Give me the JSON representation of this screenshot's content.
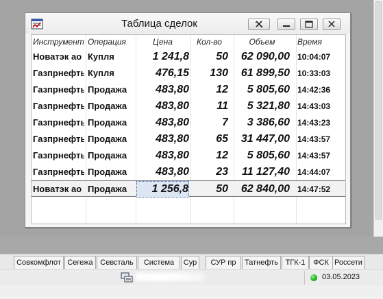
{
  "window": {
    "title": "Таблица сделок",
    "columns": {
      "instrument": "Инструмент",
      "operation": "Операция",
      "price": "Цена",
      "qty": "Кол-во",
      "volume": "Объем",
      "time": "Время"
    },
    "rows": [
      {
        "instrument": "Новатэк ао",
        "operation": "Купля",
        "price": "1 241,8",
        "qty": "50",
        "volume": "62 090,00",
        "time": "10:04:07"
      },
      {
        "instrument": "Газпрнефть",
        "operation": "Купля",
        "price": "476,15",
        "qty": "130",
        "volume": "61 899,50",
        "time": "10:33:03"
      },
      {
        "instrument": "Газпрнефть",
        "operation": "Продажа",
        "price": "483,80",
        "qty": "12",
        "volume": "5 805,60",
        "time": "14:42:36"
      },
      {
        "instrument": "Газпрнефть",
        "operation": "Продажа",
        "price": "483,80",
        "qty": "11",
        "volume": "5 321,80",
        "time": "14:43:03"
      },
      {
        "instrument": "Газпрнефть",
        "operation": "Продажа",
        "price": "483,80",
        "qty": "7",
        "volume": "3 386,60",
        "time": "14:43:23"
      },
      {
        "instrument": "Газпрнефть",
        "operation": "Продажа",
        "price": "483,80",
        "qty": "65",
        "volume": "31 447,00",
        "time": "14:43:57"
      },
      {
        "instrument": "Газпрнефть",
        "operation": "Продажа",
        "price": "483,80",
        "qty": "12",
        "volume": "5 805,60",
        "time": "14:43:57"
      },
      {
        "instrument": "Газпрнефть",
        "operation": "Продажа",
        "price": "483,80",
        "qty": "23",
        "volume": "11 127,40",
        "time": "14:44:07"
      },
      {
        "instrument": "Новатэк ао",
        "operation": "Продажа",
        "price": "1 256,8",
        "qty": "50",
        "volume": "62 840,00",
        "time": "14:47:52"
      }
    ],
    "selected_row": 8
  },
  "tabs": [
    "Совкомфлот",
    "Сегежа",
    "Севсталь",
    "Система",
    "Сур",
    "СУР пр",
    "Татнефть",
    "ТГК-1",
    "ФСК",
    "Россети"
  ],
  "status": {
    "date": "03.05.2023",
    "connection_color": "#18b018"
  }
}
